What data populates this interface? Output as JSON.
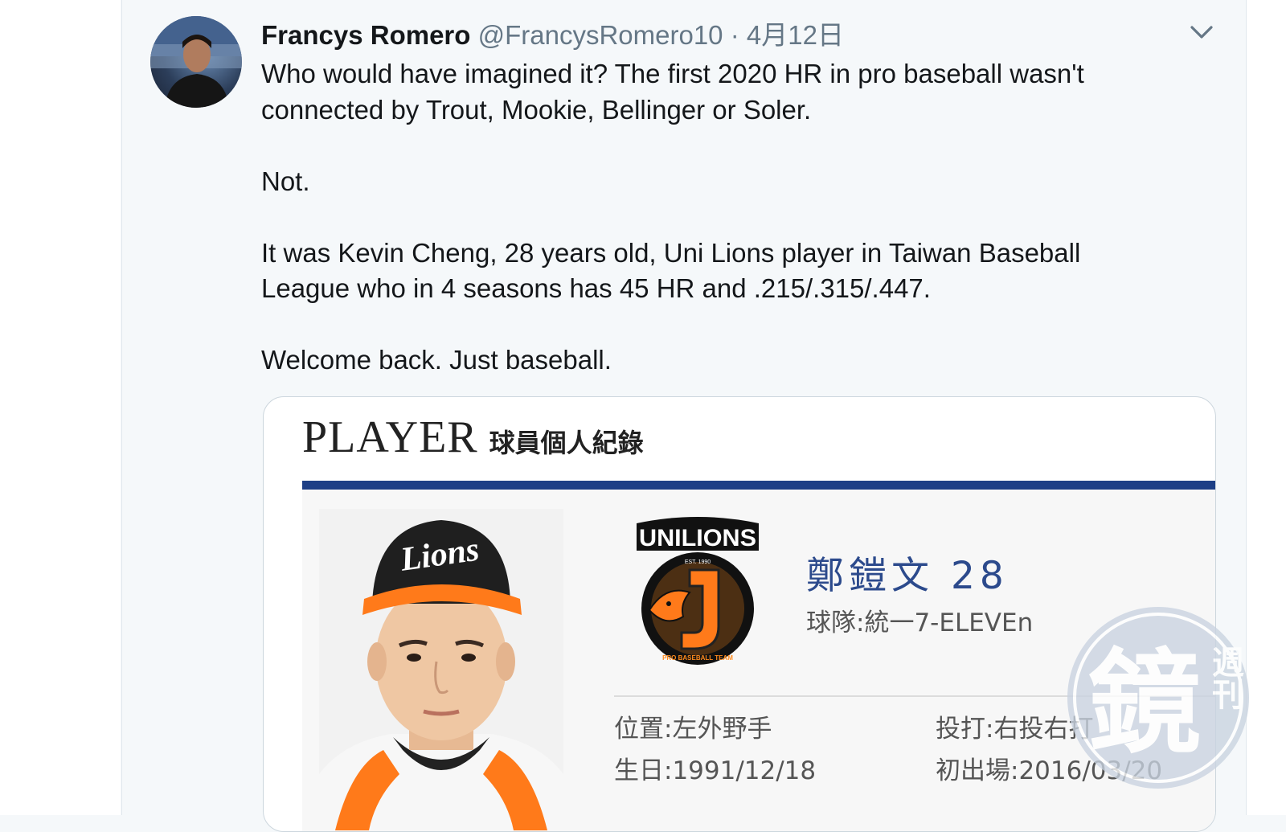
{
  "tweet": {
    "author_name": "Francys Romero",
    "author_handle": "@FrancysRomero10",
    "separator": "·",
    "date": "4月12日",
    "menu_icon": "chevron-down-icon",
    "paragraphs": [
      "Who would have imagined it? The first 2020 HR in pro baseball wasn't connected by Trout, Mookie, Bellinger or Soler.",
      "Not.",
      "It was Kevin Cheng, 28 years old, Uni Lions player in Taiwan Baseball League who in 4 seasons has 45 HR and .215/.315/.447.",
      "Welcome back. Just baseball."
    ]
  },
  "card": {
    "title_en": "PLAYER",
    "title_zh": "球員個人紀錄",
    "player_name": "鄭鎧文  28",
    "team": "球隊:統一7-ELEVEn",
    "logo_text": "UNILIONS",
    "logo_est": "EST. 1990",
    "logo_bottom": "PRO BASEBALL TEAM",
    "cap_text": "Lions",
    "position": "位置:左外野手",
    "bats_throws": "投打:右投右打",
    "birthday": "生日:1991/12/18",
    "debut": "初出場:2016/03/20",
    "accent_color": "#1d3f86"
  },
  "watermark": {
    "main_char": "鏡",
    "side_chars": "週刊"
  }
}
